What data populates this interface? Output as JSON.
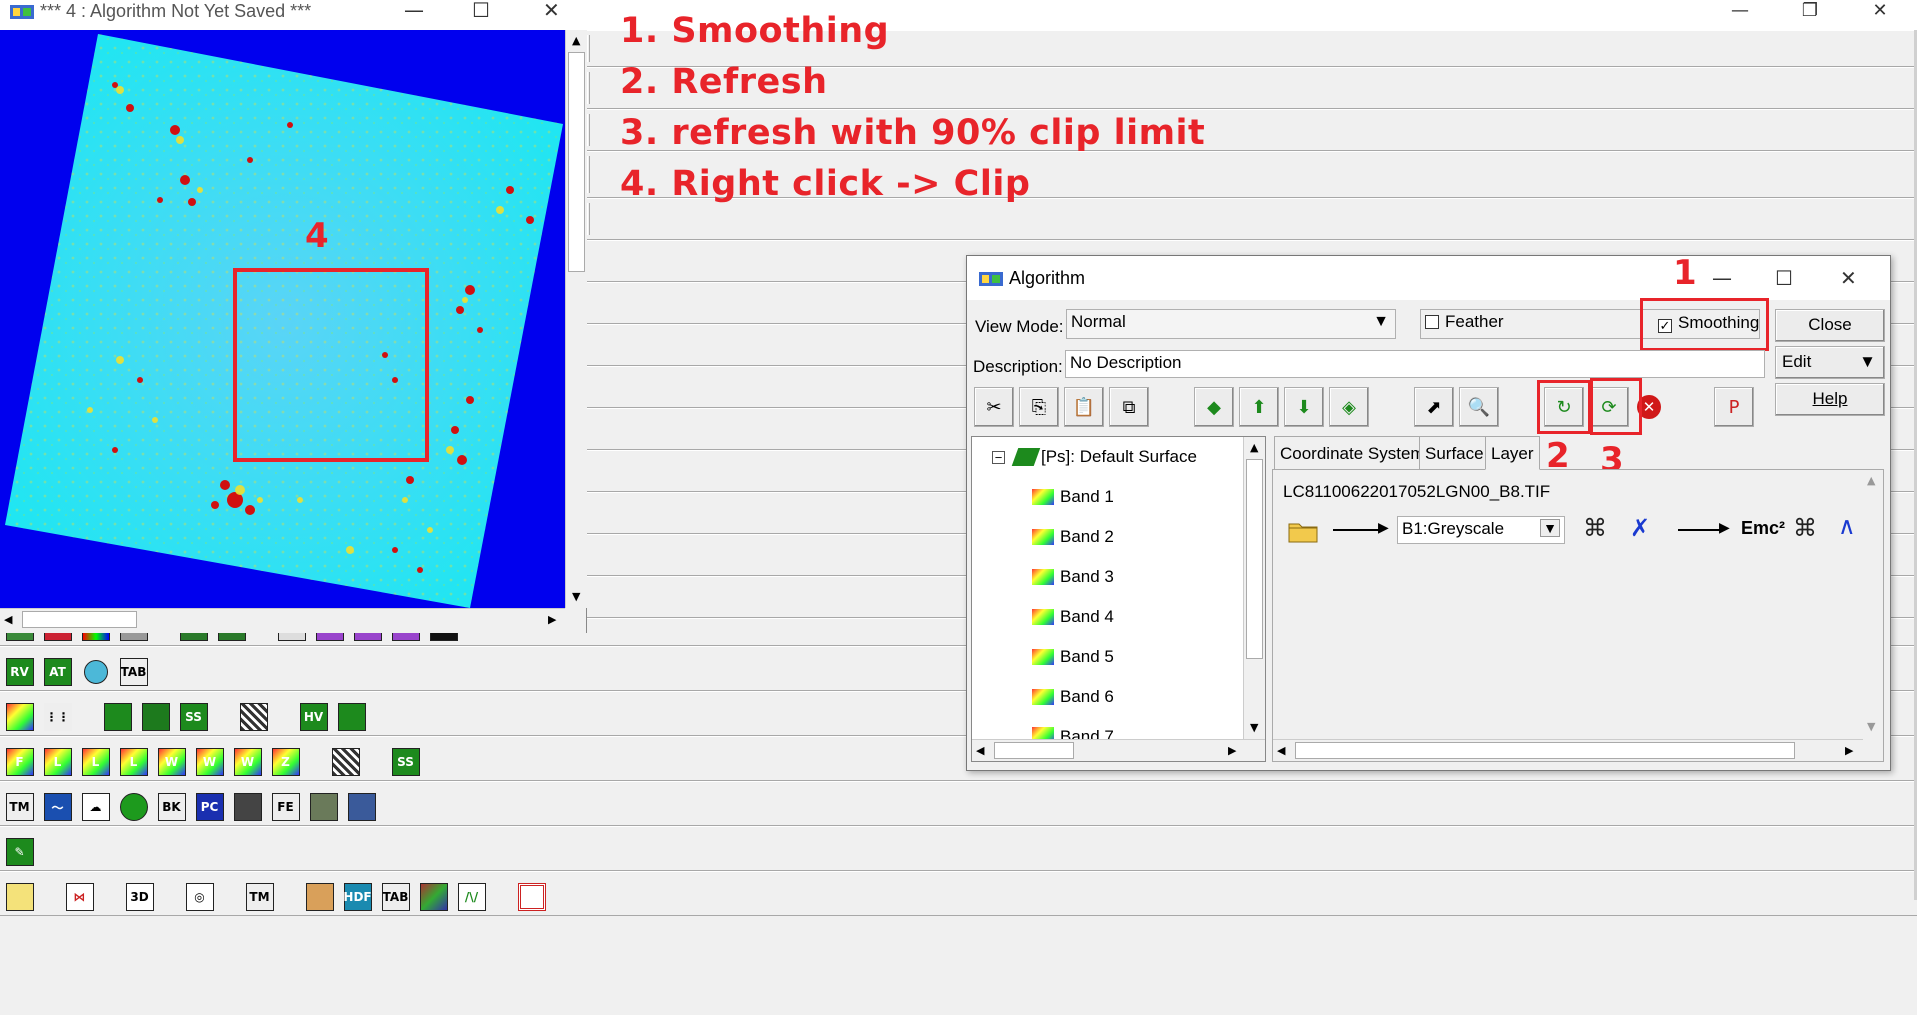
{
  "main_window": {
    "caption_buttons": {
      "minimize": "—",
      "restore": "❐",
      "close": "✕"
    }
  },
  "instructions": [
    "1. Smoothing",
    "2. Refresh",
    "3. refresh with 90% clip limit",
    "4. Right click -> Clip"
  ],
  "image_window": {
    "title": "*** 4 : Algorithm Not Yet Saved ***",
    "caption_buttons": {
      "minimize": "—",
      "maximize": "☐",
      "close": "✕"
    },
    "annotation_number": "4"
  },
  "toolbars": {
    "row1_labels": [
      "RV",
      "AT",
      "",
      "TAB"
    ],
    "row3_labels": [
      "F",
      "L",
      "L",
      "L",
      "W",
      "W",
      "W",
      "Z",
      "",
      "SS"
    ],
    "row4_labels": [
      "TM",
      "",
      "",
      "",
      "BK",
      "PC",
      "",
      "FE",
      "",
      ""
    ],
    "row6_labels": [
      "",
      "",
      "3D",
      "",
      "TM",
      "",
      "HDF",
      "TAB",
      "",
      "",
      ""
    ]
  },
  "algorithm_dialog": {
    "title": "Algorithm",
    "caption_buttons": {
      "minimize": "—",
      "maximize": "☐",
      "close": "✕"
    },
    "view_mode_label": "View Mode:",
    "view_mode_value": "Normal",
    "feather_label": "Feather",
    "feather_checked": false,
    "smoothing_label": "Smoothing",
    "smoothing_checked": true,
    "description_label": "Description:",
    "description_value": "No Description",
    "close_button": "Close",
    "edit_button": "Edit",
    "help_button": "Help",
    "tree": {
      "root": "[Ps]: Default Surface",
      "bands": [
        "Band 1",
        "Band 2",
        "Band 3",
        "Band 4",
        "Band 5",
        "Band 6",
        "Band 7"
      ]
    },
    "tabs": [
      "Coordinate System",
      "Surface",
      "Layer"
    ],
    "active_tab": "Layer",
    "layer": {
      "file_name": "LC81100622017052LGN00_B8.TIF",
      "band_select": "B1:Greyscale",
      "formula_label": "Emc²"
    },
    "annotations": [
      "1",
      "2",
      "3"
    ]
  },
  "colors": {
    "annotation_red": "#e8242a",
    "image_background": "#0000ee",
    "image_cyan": "#17e6f4"
  }
}
